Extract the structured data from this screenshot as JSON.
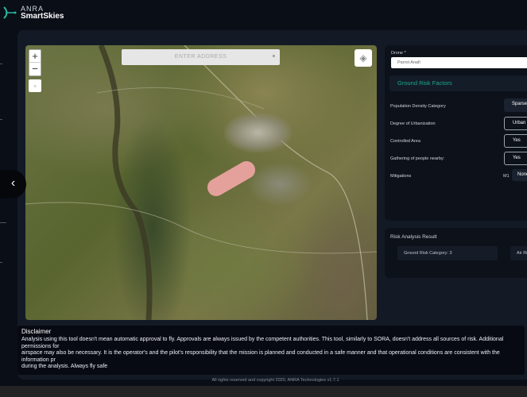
{
  "brand": {
    "line1": "ANRA",
    "line2": "SmartSkies"
  },
  "map": {
    "zoom_in": "+",
    "zoom_out": "−",
    "address_placeholder": "ENTER ADDRESS",
    "address_clear": "×"
  },
  "drone": {
    "label": "Drone",
    "required": "*",
    "value": "Parrot Anafi"
  },
  "ground_risk": {
    "title": "Ground Risk Factors",
    "population_label": "Population Density Category",
    "population_value": "Sparsely",
    "urbanization_label": "Degree of Urbanization",
    "urbanization_value": "Urban -",
    "controlled_label": "Controlled Area",
    "controlled_value": "Yes",
    "gathering_label": "Gathering of people nearby:",
    "gathering_value": "Yes",
    "mitigations_label": "Mitigations",
    "mitigations_prefix": "M1",
    "mitigations_value": "None"
  },
  "risk": {
    "title": "Risk Analysis Result",
    "ground": "Ground Risk Category: 3",
    "air": "Air Risk"
  },
  "disclaimer": {
    "title": "Disclaimer",
    "lines": [
      "Analysis using this tool doesn't mean automatic approval to fly. Approvals are always issued by the competent authorities. This tool, similarly to SORA, doesn't address all sources of risk. Additional permissions for",
      "airspace may also be necessary. It is the operator's and the pilot's responsibility that the mission is planned and conducted in a safe manner and that operational conditions are consistent with the information pr",
      "during the analysis. Always fly safe"
    ]
  },
  "footer": "All rights reserved and copyright 2020, ANRA Technologies v1.7.1",
  "nav": {
    "collapse": "‹"
  }
}
